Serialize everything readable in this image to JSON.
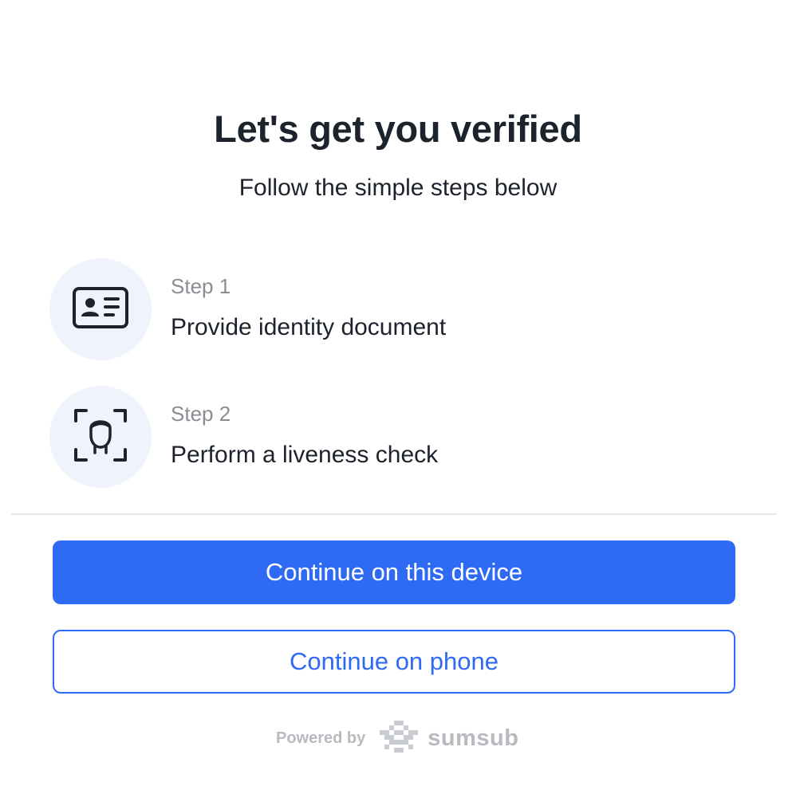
{
  "header": {
    "title": "Let's get you verified",
    "subtitle": "Follow the simple steps below"
  },
  "steps": [
    {
      "label": "Step 1",
      "text": "Provide identity document",
      "icon": "id-card-icon"
    },
    {
      "label": "Step 2",
      "text": "Perform a liveness check",
      "icon": "face-scan-icon"
    }
  ],
  "actions": {
    "primary_label": "Continue on this device",
    "secondary_label": "Continue on phone"
  },
  "footer": {
    "powered_by": "Powered by",
    "brand": "sumsub",
    "brand_icon": "sumsub-logo-icon"
  },
  "colors": {
    "accent": "#2f6af5",
    "text": "#1d232c",
    "muted": "#8a8e94",
    "icon_bg": "#eff3fb"
  }
}
